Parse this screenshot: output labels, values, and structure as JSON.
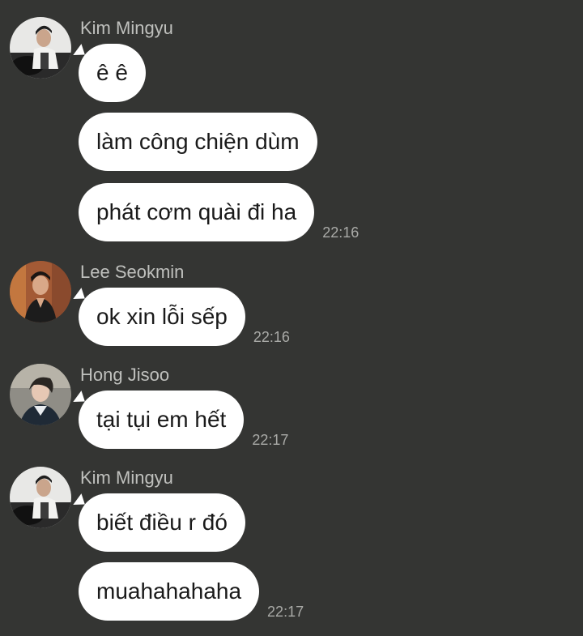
{
  "messages": [
    {
      "sender": "Kim Mingyu",
      "avatar": "kim-mingyu-avatar",
      "bubbles": [
        "ê ê",
        "làm công chiện dùm",
        "phát cơm quài đi ha"
      ],
      "time": "22:16"
    },
    {
      "sender": "Lee Seokmin",
      "avatar": "lee-seokmin-avatar",
      "bubbles": [
        "ok xin lỗi sếp"
      ],
      "time": "22:16"
    },
    {
      "sender": "Hong Jisoo",
      "avatar": "hong-jisoo-avatar",
      "bubbles": [
        "tại tụi em hết"
      ],
      "time": "22:17"
    },
    {
      "sender": "Kim Mingyu",
      "avatar": "kim-mingyu-avatar",
      "bubbles": [
        "biết điều r đó",
        "muahahahaha"
      ],
      "time": "22:17"
    }
  ],
  "colors": {
    "background": "#343533",
    "bubble": "#ffffff",
    "sender_text": "#bfc0bd",
    "time_text": "#a9aaa7"
  }
}
